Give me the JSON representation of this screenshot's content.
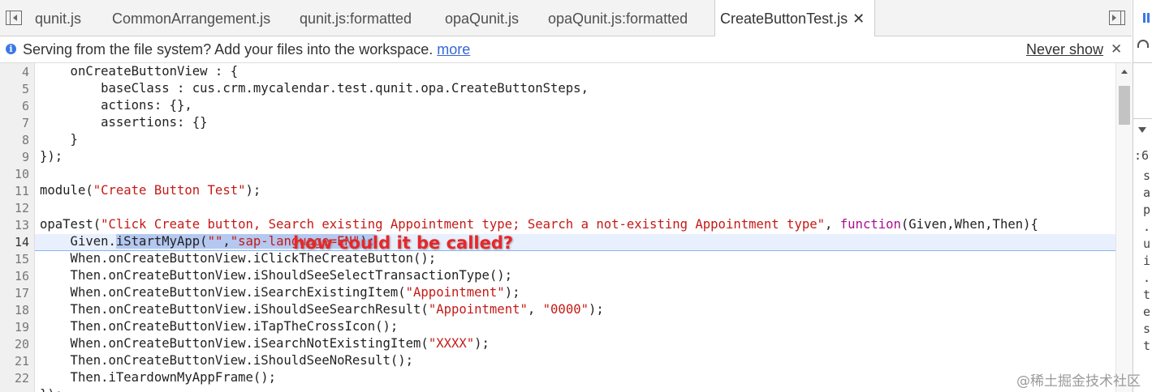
{
  "tabs": [
    {
      "label": "qunit.js"
    },
    {
      "label": "CommonArrangement.js"
    },
    {
      "label": "qunit.js:formatted"
    },
    {
      "label": "opaQunit.js"
    },
    {
      "label": "opaQunit.js:formatted"
    },
    {
      "label": "CreateButtonTest.js",
      "active": true
    }
  ],
  "tab_close_glyph": "✕",
  "infobar": {
    "message": "Serving from the file system? Add your files into the workspace.",
    "more_link": "more",
    "never_show": "Never show",
    "close_glyph": "✕"
  },
  "editor": {
    "line_numbers": [
      "4",
      "5",
      "6",
      "7",
      "8",
      "9",
      "10",
      "11",
      "12",
      "13",
      "14",
      "15",
      "16",
      "17",
      "18",
      "19",
      "20",
      "21",
      "22"
    ],
    "current_line": "14",
    "lines": {
      "l4": "    onCreateButtonView : {",
      "l5": "        baseClass : cus.crm.mycalendar.test.qunit.opa.CreateButtonSteps,",
      "l6": "        actions: {},",
      "l7": "        assertions: {}",
      "l8": "    }",
      "l9": "});",
      "l11a": "module(",
      "l11s": "\"Create Button Test\"",
      "l11b": ");",
      "l13a": "opaTest(",
      "l13s": "\"Click Create button, Search existing Appointment type; Search a not-existing Appointment type\"",
      "l13b": ", ",
      "l13k": "function",
      "l13c": "(Given,When,Then){",
      "l14a": "    Given.",
      "l14sel1": "iStartMyApp(",
      "l14s1": "\"\"",
      "l14sel2": ",",
      "l14s2": "\"sap-language=EN\"",
      "l14sel3": ");",
      "l15": "    When.onCreateButtonView.iClickTheCreateButton();",
      "l16": "    Then.onCreateButtonView.iShouldSeeSelectTransactionType();",
      "l17a": "    When.onCreateButtonView.iSearchExistingItem(",
      "l17s": "\"Appointment\"",
      "l17b": ");",
      "l18a": "    Then.onCreateButtonView.iShouldSeeSearchResult(",
      "l18s1": "\"Appointment\"",
      "l18c": ", ",
      "l18s2": "\"0000\"",
      "l18b": ");",
      "l19": "    Then.onCreateButtonView.iTapTheCrossIcon();",
      "l20a": "    When.onCreateButtonView.iSearchNotExistingItem(",
      "l20s": "\"XXXX\"",
      "l20b": ");",
      "l21": "    Then.onCreateButtonView.iShouldSeeNoResult();",
      "l22": "    Then.iTeardownMyAppFrame();",
      "l23": "});"
    }
  },
  "annotation": "how could it be called?",
  "right_panel": {
    "top_text": "II",
    "prefix": ":6",
    "chars": [
      "s",
      "a",
      "p",
      ".",
      "u",
      "i",
      ".",
      "t",
      "e",
      "s",
      "t"
    ]
  },
  "watermark": "@稀土掘金技术社区",
  "colors": {
    "string": "#c41a16",
    "keyword": "#aa0d91",
    "annotation": "#e8262a",
    "link": "#3367d6"
  }
}
